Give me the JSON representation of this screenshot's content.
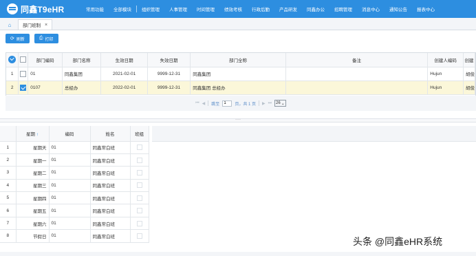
{
  "app": {
    "title": "同鑫T9eHR",
    "brand_color": "#2d8ee0"
  },
  "nav": {
    "items": [
      "常用功能",
      "全部模块",
      "组织管理",
      "人事管理",
      "时间管理",
      "绩效考核",
      "行政后勤",
      "产品研发",
      "同鑫办公",
      "招聘管理",
      "消息中心",
      "通知公告",
      "报表中心"
    ]
  },
  "tabs": {
    "home_icon": "home-icon",
    "active_label": "部门班制",
    "close_glyph": "×"
  },
  "toolbar": {
    "refresh_label": "刷新",
    "print_label": "打印"
  },
  "main_grid": {
    "columns": [
      "部门编码",
      "部门名称",
      "生效日期",
      "失效日期",
      "部门全称",
      "备注",
      "创建人编码",
      "创建"
    ],
    "rows": [
      {
        "index": "1",
        "checked": false,
        "code": "01",
        "name": "同鑫集团",
        "start": "2021-02-01",
        "end": "9999-12-31",
        "fullname": "同鑫集团",
        "remark": "",
        "creator": "Hujun",
        "extra": "胡俊"
      },
      {
        "index": "2",
        "checked": true,
        "code": "0107",
        "name": "总经办",
        "start": "2022-02-01",
        "end": "9999-12-31",
        "fullname": "同鑫集团 总经办",
        "remark": "",
        "creator": "Hujun",
        "extra": "胡俊"
      }
    ]
  },
  "pager": {
    "goto_label": "跳至",
    "page_value": "1",
    "page_suffix": "页，共 1 页",
    "page_size": "26"
  },
  "splitter": {
    "glyph": "····"
  },
  "sub_grid": {
    "columns": [
      "星期",
      "编码",
      "姓名",
      "班组"
    ],
    "sort_indicator": "↑",
    "rows": [
      {
        "index": "1",
        "day": "星期天",
        "code": "01",
        "name": "同鑫常白班"
      },
      {
        "index": "2",
        "day": "星期一",
        "code": "01",
        "name": "同鑫常白班"
      },
      {
        "index": "3",
        "day": "星期二",
        "code": "01",
        "name": "同鑫常白班"
      },
      {
        "index": "4",
        "day": "星期三",
        "code": "01",
        "name": "同鑫常白班"
      },
      {
        "index": "5",
        "day": "星期四",
        "code": "01",
        "name": "同鑫常白班"
      },
      {
        "index": "6",
        "day": "星期五",
        "code": "01",
        "name": "同鑫常白班"
      },
      {
        "index": "7",
        "day": "星期六",
        "code": "01",
        "name": "同鑫常白班"
      },
      {
        "index": "8",
        "day": "节假日",
        "code": "01",
        "name": "同鑫常白班"
      }
    ]
  },
  "watermark": "头条 @同鑫eHR系统"
}
